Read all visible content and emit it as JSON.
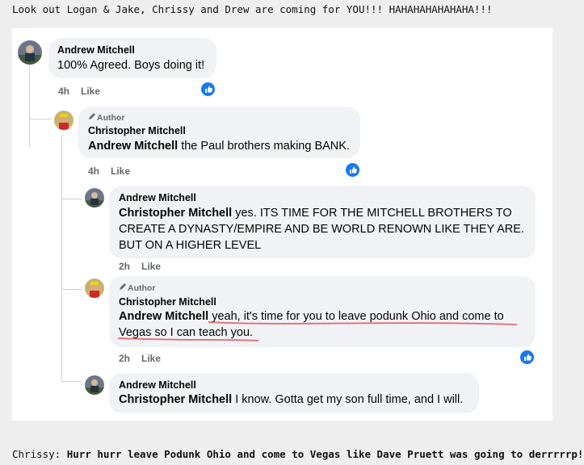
{
  "header_text": "Look out Logan & Jake, Chrissy and Drew are coming for YOU!!! HAHAHAHAHAHAHA!!!",
  "footer": {
    "speaker": "Chrissy:",
    "quote": "Hurr hurr leave Podunk Ohio and come to Vegas like Dave Pruett was going to derrrrrp!"
  },
  "author_label": "Author",
  "like_label": "Like",
  "comments": [
    {
      "name": "Andrew Mitchell",
      "text": "100% Agreed. Boys doing it!",
      "time": "4h"
    },
    {
      "name": "Christopher Mitchell",
      "mention": "Andrew Mitchell",
      "text": " the Paul brothers making BANK.",
      "time": "4h"
    },
    {
      "name": "Andrew Mitchell",
      "mention": "Christopher Mitchell",
      "text": " yes. ITS TIME FOR THE MITCHELL BROTHERS TO CREATE A DYNASTY/EMPIRE AND BE WORLD RENOWN LIKE THEY ARE. BUT ON A HIGHER LEVEL",
      "time": "2h"
    },
    {
      "name": "Christopher Mitchell",
      "mention": "Andrew Mitchell",
      "text": " yeah, it's time for you to leave podunk Ohio and come to Vegas so I can teach you.",
      "time": "2h"
    },
    {
      "name": "Andrew Mitchell",
      "mention": "Christopher Mitchell",
      "text": " I know. Gotta get my son full time, and I will."
    }
  ],
  "colors": {
    "like_blue": "#1877f2",
    "bubble_bg": "#f0f2f5",
    "meta_gray": "#65676b",
    "underline_red": "#e0444a"
  }
}
